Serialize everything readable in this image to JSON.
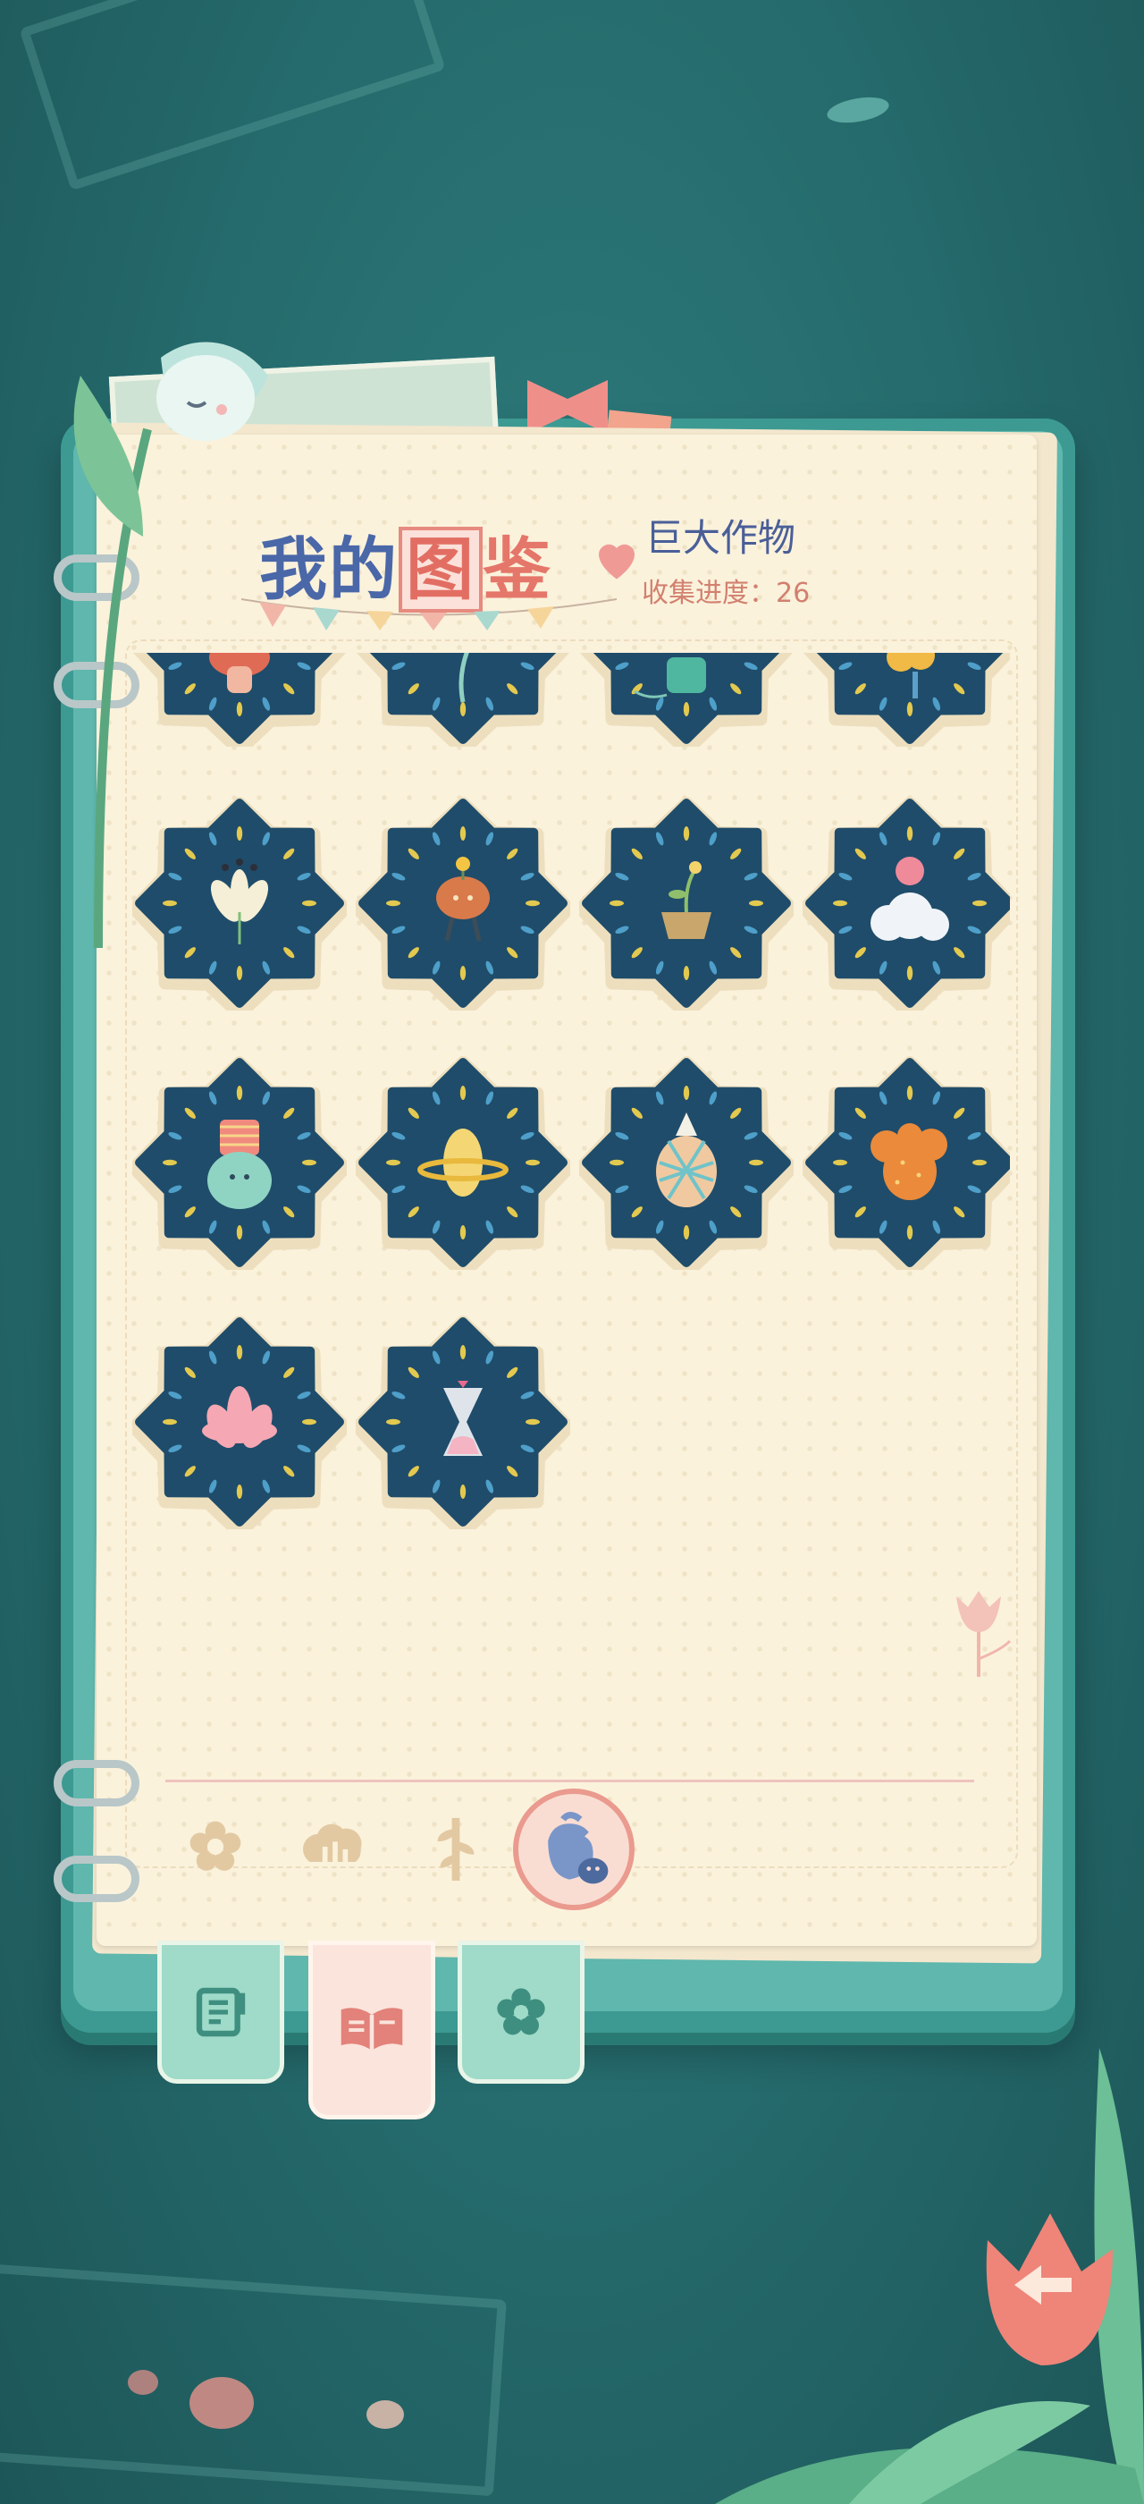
{
  "header": {
    "title_part1": "我的",
    "title_part2": "图",
    "title_part3": "鉴",
    "category_name": "巨大作物",
    "progress_label": "收集进度：",
    "progress_value": "26"
  },
  "collection": {
    "items": [
      {
        "name": "mushroom-creature",
        "icon": "mushroom-icon",
        "color": "#e06b55",
        "partial": true
      },
      {
        "name": "sparkle-sprout",
        "icon": "sprout-icon",
        "color": "#8fd0c2",
        "partial": true
      },
      {
        "name": "digital-cactus",
        "icon": "cactus-icon",
        "color": "#4fb6a0",
        "partial": true
      },
      {
        "name": "yellow-bloom",
        "icon": "flower-icon",
        "color": "#f1b945",
        "partial": true
      },
      {
        "name": "night-lily",
        "icon": "lily-icon",
        "color": "#f4efd6"
      },
      {
        "name": "walking-pot-flower",
        "icon": "pot-flower-icon",
        "color": "#d97a4a"
      },
      {
        "name": "clay-pot-sprout",
        "icon": "clay-pot-icon",
        "color": "#c9a66b"
      },
      {
        "name": "cloud-peach",
        "icon": "cloud-peach-icon",
        "color": "#f0f4f8"
      },
      {
        "name": "woven-jar-ghost",
        "icon": "jar-icon",
        "color": "#f08a7e"
      },
      {
        "name": "ringed-planet-corn",
        "icon": "planet-icon",
        "color": "#f4d774"
      },
      {
        "name": "mosaic-pineapple",
        "icon": "pineapple-icon",
        "color": "#f1c9a0"
      },
      {
        "name": "orange-cactus",
        "icon": "orange-cactus-icon",
        "color": "#ea8a3a"
      },
      {
        "name": "pink-lotus",
        "icon": "lotus-icon",
        "color": "#f5a7b3"
      },
      {
        "name": "heart-hourglass",
        "icon": "hourglass-icon",
        "color": "#f4b4c4"
      }
    ]
  },
  "category_tabs": [
    {
      "icon": "flower-outline-icon",
      "active": false
    },
    {
      "icon": "bush-icon",
      "active": false
    },
    {
      "icon": "fern-icon",
      "active": false
    },
    {
      "icon": "giant-crop-icon",
      "active": true
    }
  ],
  "side_tabs": [
    {
      "icon": "notebook-icon",
      "active": false
    },
    {
      "icon": "open-book-icon",
      "active": true
    },
    {
      "icon": "flower-tab-icon",
      "active": false
    }
  ],
  "colors": {
    "background": "#256a6c",
    "book_cover": "#3c9a92",
    "page": "#fbf2dc",
    "badge": "#1f4c6a",
    "accent_pink": "#ea9a8e",
    "title_blue": "#4a67a8"
  }
}
